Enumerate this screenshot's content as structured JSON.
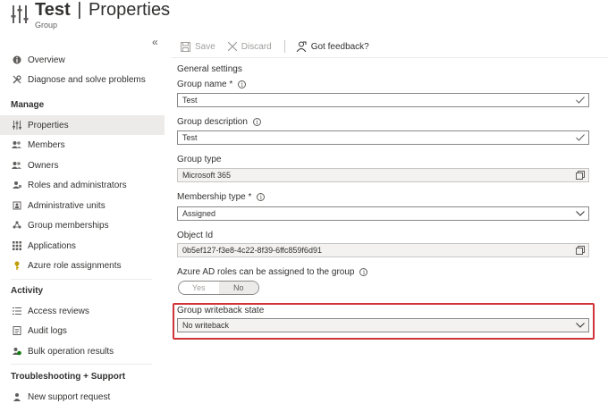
{
  "header": {
    "title": "Test",
    "separator": "|",
    "subtitle": "Properties",
    "more": "···",
    "caption": "Group"
  },
  "sidebar": {
    "collapse": "«",
    "items": [
      {
        "label": "Overview",
        "icon": "info-icon"
      },
      {
        "label": "Diagnose and solve problems",
        "icon": "wrench-icon"
      },
      {
        "label": "Properties",
        "icon": "properties-icon",
        "active": true
      },
      {
        "label": "Members",
        "icon": "members-icon"
      },
      {
        "label": "Owners",
        "icon": "owners-icon"
      },
      {
        "label": "Roles and administrators",
        "icon": "roles-icon"
      },
      {
        "label": "Administrative units",
        "icon": "admin-units-icon"
      },
      {
        "label": "Group memberships",
        "icon": "group-memberships-icon"
      },
      {
        "label": "Applications",
        "icon": "applications-icon"
      },
      {
        "label": "Azure role assignments",
        "icon": "key-icon"
      },
      {
        "label": "Access reviews",
        "icon": "access-reviews-icon"
      },
      {
        "label": "Audit logs",
        "icon": "audit-logs-icon"
      },
      {
        "label": "Bulk operation results",
        "icon": "bulk-results-icon"
      },
      {
        "label": "New support request",
        "icon": "support-icon"
      }
    ],
    "sections": {
      "manage": "Manage",
      "activity": "Activity",
      "troubleshooting": "Troubleshooting + Support"
    }
  },
  "toolbar": {
    "save": "Save",
    "discard": "Discard",
    "feedback": "Got feedback?"
  },
  "form": {
    "title": "General settings",
    "group_name_label": "Group name *",
    "group_name_value": "Test",
    "group_description_label": "Group description",
    "group_description_value": "Test",
    "group_type_label": "Group type",
    "group_type_value": "Microsoft 365",
    "membership_type_label": "Membership type *",
    "membership_type_value": "Assigned",
    "object_id_label": "Object Id",
    "object_id_value": "0b5ef127-f3e8-4c22-8f39-6ffc859f6d91",
    "roles_label": "Azure AD roles can be assigned to the group",
    "roles_yes": "Yes",
    "roles_no": "No",
    "roles_selected": "No",
    "writeback_label": "Group writeback state",
    "writeback_value": "No writeback"
  },
  "colors": {
    "highlight": "#d13438",
    "active_bg": "#edebe9",
    "accent": "#0078d4"
  }
}
